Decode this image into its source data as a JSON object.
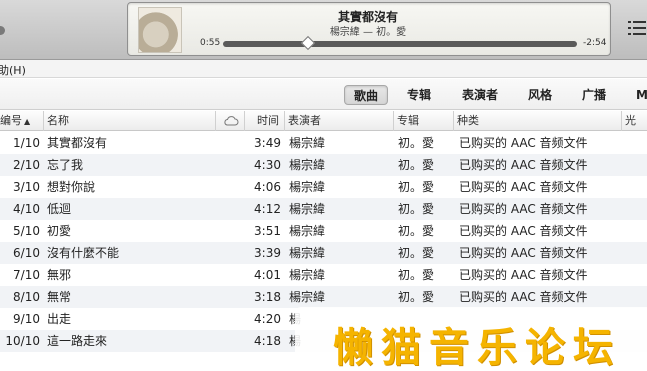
{
  "player": {
    "song_title": "其實都沒有",
    "song_subtitle": "楊宗緯 — 初。愛",
    "elapsed": "0:55",
    "remaining": "-2:54",
    "progress_fraction": 0.24
  },
  "menubar": {
    "help_label": "助(H)"
  },
  "tabs": [
    {
      "label": "歌曲",
      "active": true
    },
    {
      "label": "专辑",
      "active": false
    },
    {
      "label": "表演者",
      "active": false
    },
    {
      "label": "风格",
      "active": false
    },
    {
      "label": "广播",
      "active": false
    },
    {
      "label": "M",
      "active": false
    }
  ],
  "columns": {
    "num": "编号",
    "name": "名称",
    "time": "时间",
    "artist": "表演者",
    "album": "专辑",
    "kind": "种类",
    "extra": "光"
  },
  "rows": [
    {
      "num": "1/10",
      "name": "其實都沒有",
      "time": "3:49",
      "artist": "楊宗緯",
      "album": "初。愛",
      "kind": "已购买的 AAC 音频文件"
    },
    {
      "num": "2/10",
      "name": "忘了我",
      "time": "4:30",
      "artist": "楊宗緯",
      "album": "初。愛",
      "kind": "已购买的 AAC 音频文件"
    },
    {
      "num": "3/10",
      "name": "想對你說",
      "time": "4:06",
      "artist": "楊宗緯",
      "album": "初。愛",
      "kind": "已购买的 AAC 音频文件"
    },
    {
      "num": "4/10",
      "name": "低迴",
      "time": "4:12",
      "artist": "楊宗緯",
      "album": "初。愛",
      "kind": "已购买的 AAC 音频文件"
    },
    {
      "num": "5/10",
      "name": "初愛",
      "time": "3:51",
      "artist": "楊宗緯",
      "album": "初。愛",
      "kind": "已购买的 AAC 音频文件"
    },
    {
      "num": "6/10",
      "name": "沒有什麼不能",
      "time": "3:39",
      "artist": "楊宗緯",
      "album": "初。愛",
      "kind": "已购买的 AAC 音频文件"
    },
    {
      "num": "7/10",
      "name": "無邪",
      "time": "4:01",
      "artist": "楊宗緯",
      "album": "初。愛",
      "kind": "已购买的 AAC 音频文件"
    },
    {
      "num": "8/10",
      "name": "無常",
      "time": "3:18",
      "artist": "楊宗緯",
      "album": "初。愛",
      "kind": "已购买的 AAC 音频文件"
    },
    {
      "num": "9/10",
      "name": "出走",
      "time": "4:20",
      "artist": "楊",
      "album": "",
      "kind": ""
    },
    {
      "num": "10/10",
      "name": "這一路走來",
      "time": "4:18",
      "artist": "楊",
      "album": "",
      "kind": ""
    }
  ],
  "watermark": {
    "text": "懒猫音乐论坛"
  }
}
